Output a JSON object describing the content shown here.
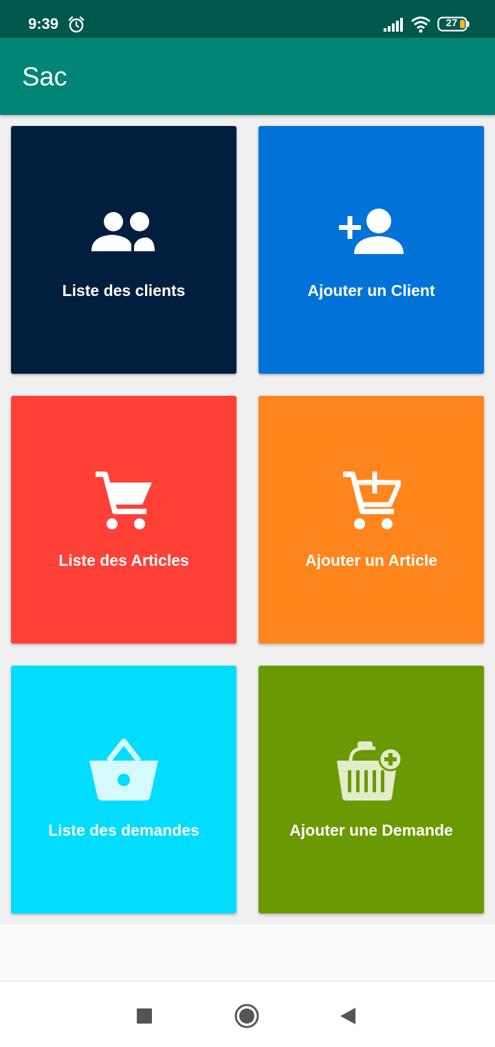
{
  "status_bar": {
    "time": "9:39",
    "battery": "27",
    "icons": [
      "alarm-icon",
      "signal-icon",
      "wifi-icon",
      "battery-icon"
    ]
  },
  "app_bar": {
    "title": "Sac",
    "color": "#008577"
  },
  "tiles": [
    {
      "label": "Liste des clients",
      "icon": "group-icon",
      "color": "#011e3f"
    },
    {
      "label": "Ajouter un Client",
      "icon": "person-add-icon",
      "color": "#0173d8"
    },
    {
      "label": "Liste des Articles",
      "icon": "cart-icon",
      "color": "#ff4036"
    },
    {
      "label": "Ajouter un Article",
      "icon": "cart-add-icon",
      "color": "#ff851c"
    },
    {
      "label": "Liste des demandes",
      "icon": "basket-icon",
      "color": "#01ddfe"
    },
    {
      "label": "Ajouter une Demande",
      "icon": "basket-add-icon",
      "color": "#6a9a03"
    }
  ],
  "nav_bar": {
    "icons": [
      "recents-square-icon",
      "home-circle-icon",
      "back-triangle-icon"
    ]
  }
}
